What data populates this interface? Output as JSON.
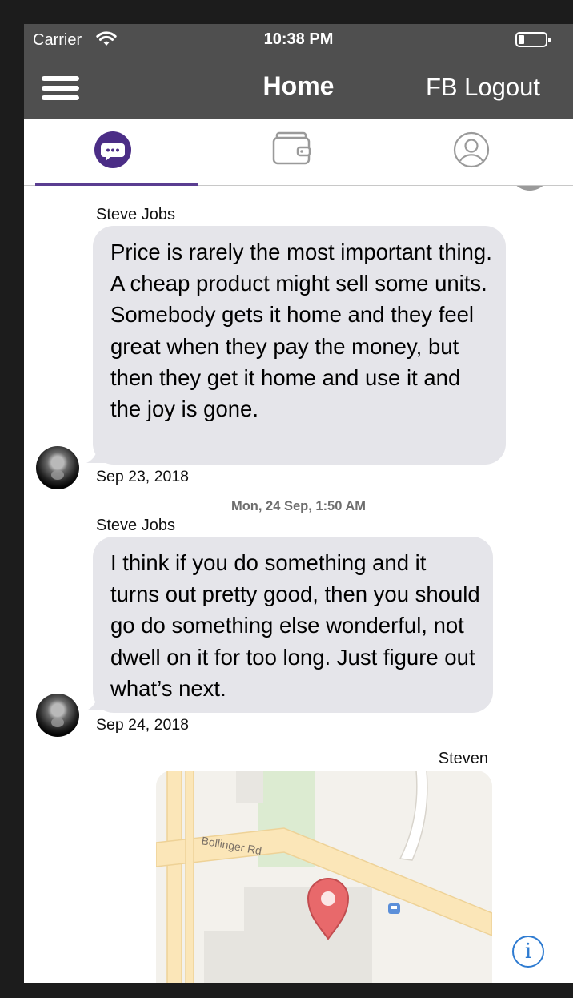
{
  "status_bar": {
    "carrier": "Carrier",
    "time": "10:38 PM",
    "icons": [
      "wifi-icon",
      "battery-icon"
    ]
  },
  "nav_bar": {
    "title": "Home",
    "logout_label": "FB Logout",
    "menu_icon": "hamburger-menu-icon"
  },
  "tabs": [
    {
      "icon": "chat-bubble-icon",
      "selected": true
    },
    {
      "icon": "wallet-icon",
      "selected": false
    },
    {
      "icon": "profile-icon",
      "selected": false
    }
  ],
  "messages": [
    {
      "sender": "Steve Jobs",
      "text": "Price is rarely the most important thing. A cheap product might sell some units. Somebody gets it home and they feel great when they pay the money, but then they get it home and use it and the joy is gone.",
      "date": "Sep 23, 2018"
    },
    {
      "separator": "Mon, 24 Sep, 1:50 AM",
      "sender": "Steve Jobs",
      "text": "I think if you do something and it turns out pretty good, then you should go do something else wonderful, not dwell on it for too long. Just figure out what’s next.",
      "date": "Sep 24, 2018"
    },
    {
      "sender": "Steven",
      "type": "location",
      "map_street_label": "Bollinger Rd"
    }
  ],
  "info_button_icon": "info-icon",
  "colors": {
    "nav_background": "#4f4f4f",
    "accent": "#5a3d91",
    "bubble": "#e5e5ea",
    "info_blue": "#2e7bd1",
    "map_pin": "#e8696b"
  }
}
